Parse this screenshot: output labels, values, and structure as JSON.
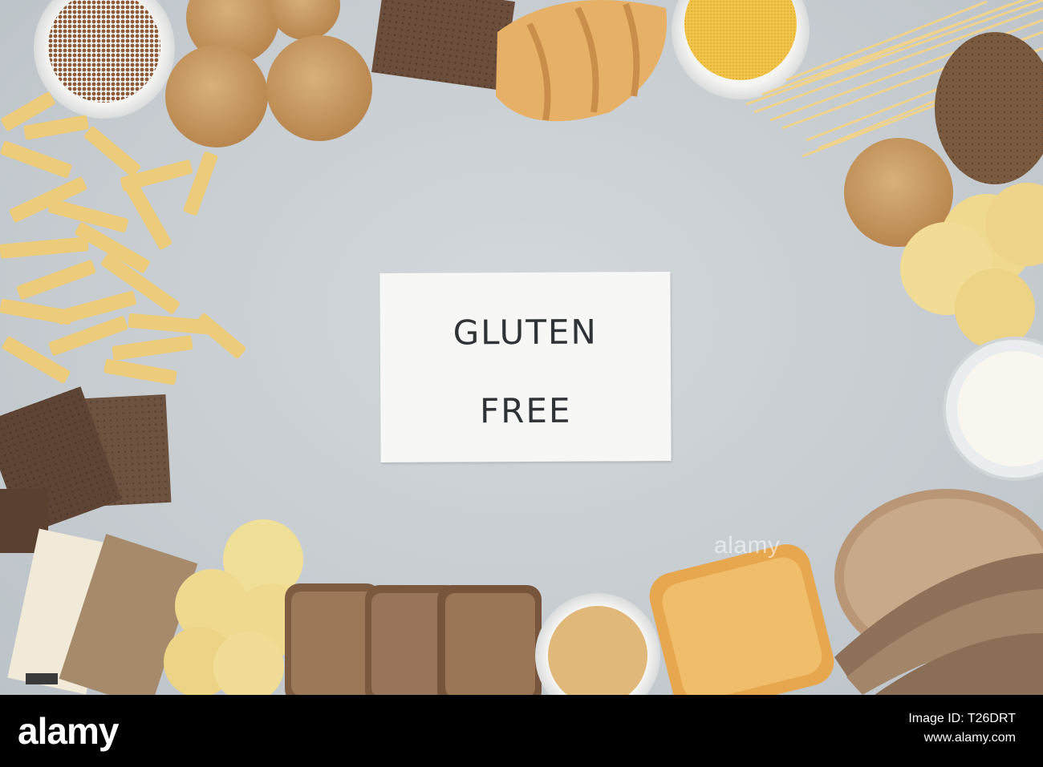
{
  "card": {
    "line1": "GLUTEN",
    "line2": "FREE"
  },
  "watermark": "alamy",
  "footer": {
    "logo": "alamy",
    "image_id_line": "Image ID: T26DRT",
    "site": "www.alamy.com"
  },
  "colors": {
    "surface": "#c9cfd3",
    "card": "#f7f7f5",
    "pasta": "#eccb7a",
    "crispbread": "#6a4d3a",
    "cookie": "#c79b64"
  }
}
